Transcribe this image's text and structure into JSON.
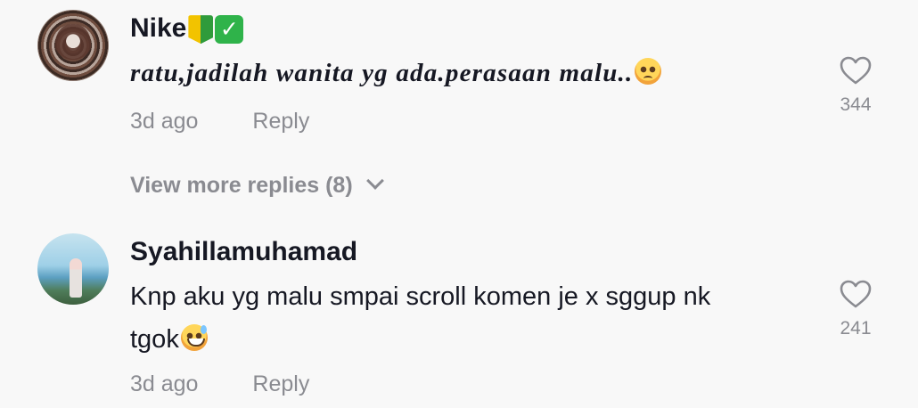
{
  "comments": [
    {
      "username": "Nike",
      "badges": [
        "beginner-badge",
        "check-mark-badge"
      ],
      "text": "ratu,jadilah wanita yg ada.perasaan malu..",
      "emoji": "pleading-face-emoji",
      "time": "3d ago",
      "reply_label": "Reply",
      "likes": "344",
      "view_more": "View more replies (8)"
    },
    {
      "username": "Syahillamuhamad",
      "text_line1": "Knp aku yg malu smpai scroll komen je x sggup nk",
      "text_line2": "tgok",
      "emoji": "grinning-sweat-emoji",
      "time": "3d ago",
      "reply_label": "Reply",
      "likes": "241"
    }
  ],
  "icons": {
    "like": "heart-outline-icon",
    "expand": "chevron-down-icon"
  },
  "colors": {
    "background": "#f8f8f8",
    "text": "#161823",
    "muted": "#8a8b91"
  }
}
